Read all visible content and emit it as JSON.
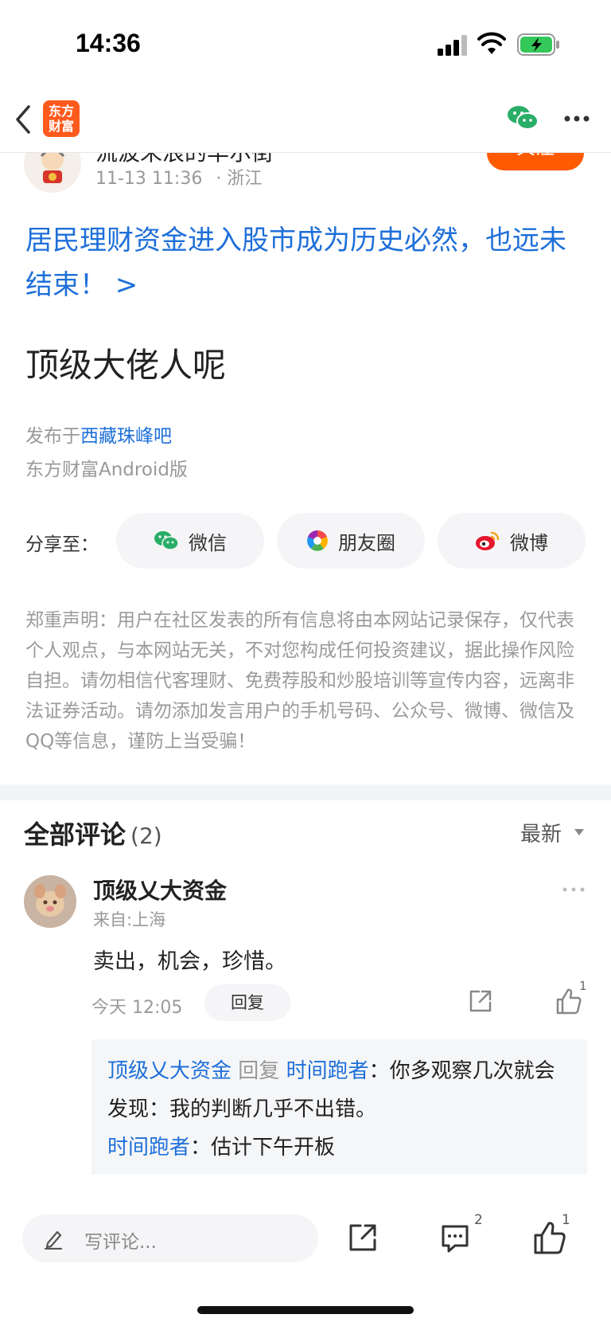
{
  "status_bar": {
    "time": "14:36"
  },
  "nav": {
    "logo_line1": "东方",
    "logo_line2": "财富"
  },
  "author": {
    "name": "流波未浪的华尔街",
    "datetime": "11-13 11:36",
    "location": "· 浙江",
    "follow_label": "关注"
  },
  "headline_link": "居民理财资金进入股市成为历史必然，也远未结束！ >",
  "post": {
    "title": "顶级大佬人呢",
    "published_prefix": "发布于",
    "board_name": "西藏珠峰吧",
    "client": "东方财富Android版"
  },
  "share": {
    "label": "分享至：",
    "wechat": "微信",
    "moments": "朋友圈",
    "weibo": "微博"
  },
  "disclaimer": "郑重声明：用户在社区发表的所有信息将由本网站记录保存，仅代表个人观点，与本网站无关，不对您构成任何投资建议，据此操作风险自担。请勿相信代客理财、免费荐股和炒股培训等宣传内容，远离非法证券活动。请勿添加发言用户的手机号码、公众号、微博、微信及QQ等信息，谨防上当受骗！",
  "comments": {
    "title": "全部评论",
    "count": "(2)",
    "sort_label": "最新",
    "items": [
      {
        "user": "顶级乂大资金",
        "location": "来自:上海",
        "text": "卖出，机会，珍惜。",
        "time": "今天 12:05",
        "reply_label": "回复",
        "like_count": "1",
        "replies": {
          "r1_user": "顶级乂大资金",
          "r1_verb": "回复",
          "r1_target": "时间跑者",
          "r1_text": "：你多观察几次就会发现：我的判断几乎不出错。",
          "r2_user": "时间跑者",
          "r2_text": "：估计下午开板"
        }
      }
    ]
  },
  "bottom_bar": {
    "input_placeholder": "写评论...",
    "comment_count": "2",
    "like_count": "1"
  },
  "colors": {
    "brand": "#ff5a00",
    "link": "#1e6fd9"
  }
}
